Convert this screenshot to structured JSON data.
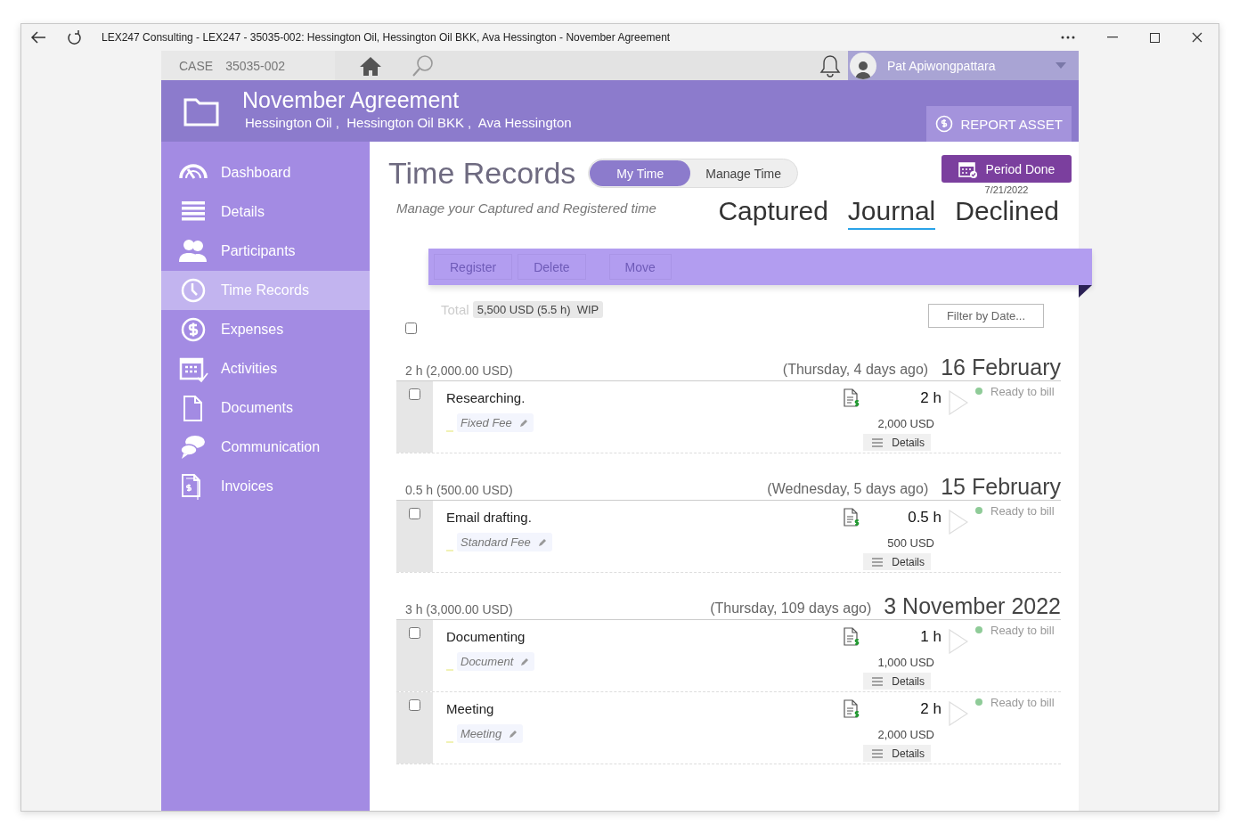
{
  "window": {
    "title": "LEX247 Consulting - LEX247 - 35035-002: Hessington Oil, Hessington Oil BKK, Ava Hessington - November Agreement"
  },
  "topbar": {
    "case_label": "CASE",
    "case_number": "35035-002",
    "user_name": "Pat Apiwongpattara"
  },
  "header": {
    "title": "November Agreement",
    "parties": "Hessington Oil ,  Hessington Oil BKK ,  Ava Hessington",
    "report_button": "REPORT ASSET"
  },
  "sidebar": {
    "items": [
      {
        "label": "Dashboard",
        "kind": "dashboard",
        "selected": false
      },
      {
        "label": "Details",
        "kind": "details",
        "selected": false
      },
      {
        "label": "Participants",
        "kind": "participants",
        "selected": false
      },
      {
        "label": "Time Records",
        "kind": "time",
        "selected": true
      },
      {
        "label": "Expenses",
        "kind": "expenses",
        "selected": false
      },
      {
        "label": "Activities",
        "kind": "activities",
        "selected": false
      },
      {
        "label": "Documents",
        "kind": "documents",
        "selected": false
      },
      {
        "label": "Communication",
        "kind": "communication",
        "selected": false
      },
      {
        "label": "Invoices",
        "kind": "invoices",
        "selected": false
      }
    ]
  },
  "page": {
    "title": "Time Records",
    "toggle": [
      {
        "label": "My Time",
        "selected": true
      },
      {
        "label": "Manage Time",
        "selected": false
      }
    ],
    "period_button": "Period Done",
    "period_date": "7/21/2022",
    "subtitle": "Manage your Captured and Registered time",
    "views": [
      {
        "label": "Captured",
        "selected": false
      },
      {
        "label": "Journal",
        "selected": true
      },
      {
        "label": "Declined",
        "selected": false
      }
    ],
    "actions": [
      {
        "label": "Register",
        "disabled": true
      },
      {
        "label": "Delete",
        "disabled": true
      },
      {
        "label": "Move",
        "disabled": true
      }
    ],
    "total_label": "Total",
    "total_value": "5,500 USD (5.5 h)  WIP",
    "select_all_checked": false,
    "filter_button": "Filter by Date..."
  },
  "groups": [
    {
      "summary": "2 h (2,000.00 USD)",
      "relative": "(Thursday, 4 days ago)",
      "date": "16 February",
      "entries": [
        {
          "description": "Researching.",
          "fee": "Fixed Fee",
          "hours": "2 h",
          "amount": "2,000 USD",
          "details": "Details",
          "status": "Ready to bill",
          "checked": false
        }
      ]
    },
    {
      "summary": "0.5 h (500.00 USD)",
      "relative": "(Wednesday, 5 days ago)",
      "date": "15 February",
      "entries": [
        {
          "description": "Email drafting.",
          "fee": "Standard Fee",
          "hours": "0.5 h",
          "amount": "500 USD",
          "details": "Details",
          "status": "Ready to bill",
          "checked": false
        }
      ]
    },
    {
      "summary": "3 h (3,000.00 USD)",
      "relative": "(Thursday, 109 days ago)",
      "date": "3 November 2022",
      "entries": [
        {
          "description": "Documenting",
          "fee": "Document",
          "hours": "1 h",
          "amount": "1,000 USD",
          "details": "Details",
          "status": "Ready to bill",
          "checked": false
        },
        {
          "description": "Meeting",
          "fee": "Meeting",
          "hours": "2 h",
          "amount": "2,000 USD",
          "details": "Details",
          "status": "Ready to bill",
          "checked": false
        }
      ]
    }
  ]
}
